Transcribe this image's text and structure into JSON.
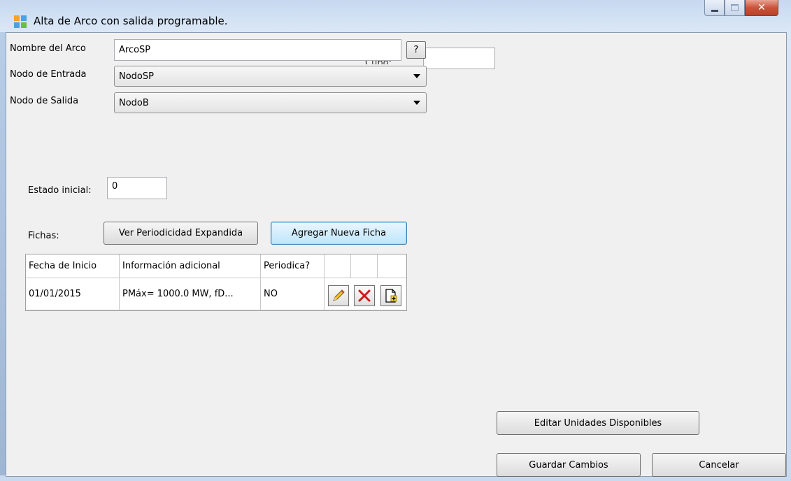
{
  "window": {
    "title": "Alta de Arco con salida programable.",
    "buttons": {
      "minimize": "minimize",
      "maximize": "maximize",
      "close": "close"
    }
  },
  "form": {
    "nombre_label": "Nombre del Arco",
    "nombre_value": "ArcoSP",
    "help_label": "?",
    "hidden_label": "Cupo:",
    "nodo_entrada_label": "Nodo de Entrada",
    "nodo_entrada_value": "NodoSP",
    "nodo_salida_label": "Nodo de Salida",
    "nodo_salida_value": "NodoB",
    "estado_inicial_label": "Estado inicial:",
    "estado_inicial_value": "0",
    "fichas_label": "Fichas:",
    "ver_periodicidad_label": "Ver Periodicidad Expandida",
    "agregar_ficha_label": "Agregar Nueva Ficha"
  },
  "table": {
    "headers": [
      "Fecha de Inicio",
      "Información adicional",
      "Periodica?"
    ],
    "rows": [
      {
        "fecha": "01/01/2015",
        "info": "PMáx= 1000.0 MW, fD...",
        "periodica": "NO"
      }
    ],
    "row_icons": [
      "pencil-icon",
      "delete-x-icon",
      "add-document-icon"
    ]
  },
  "footer": {
    "editar_unidades_label": "Editar Unidades Disponibles",
    "guardar_label": "Guardar Cambios",
    "cancelar_label": "Cancelar"
  },
  "colors": {
    "title_bar": "#c6d9f0",
    "client_bg": "#f0f0f0",
    "close_button": "#c9543b",
    "delete_icon": "#d0191b"
  }
}
